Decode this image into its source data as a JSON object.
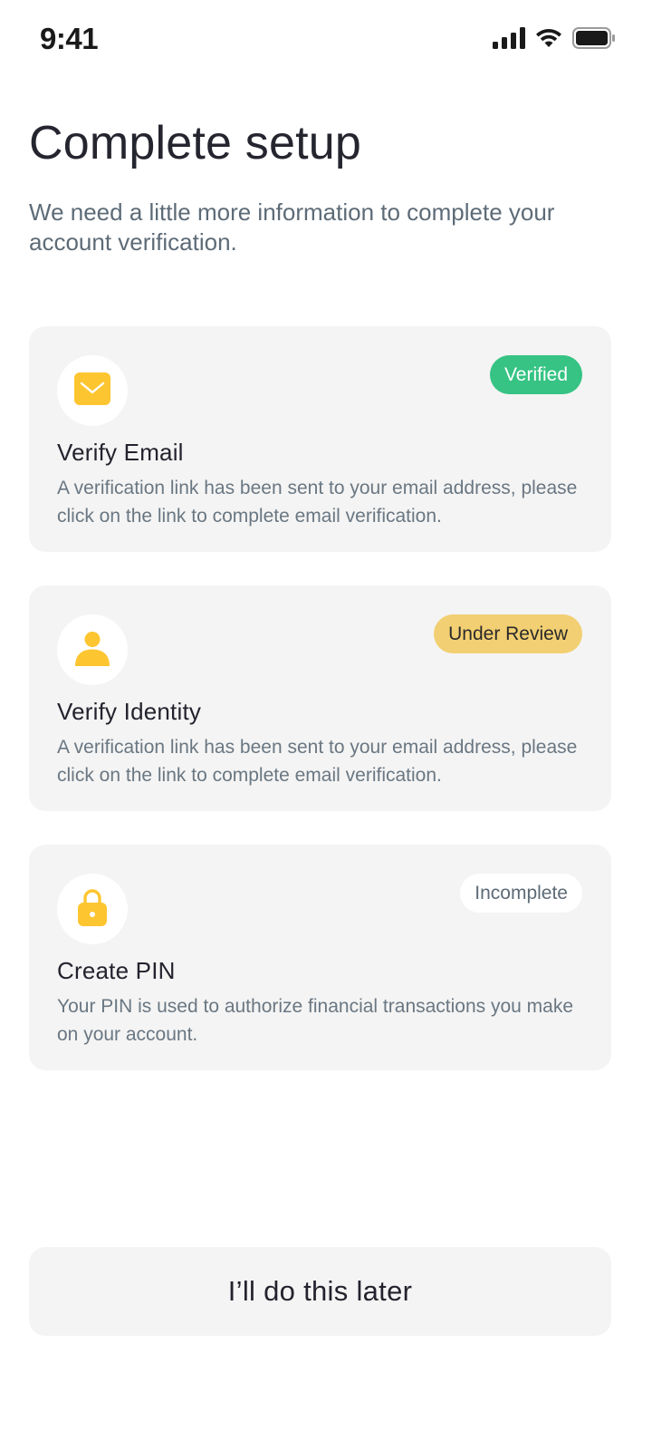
{
  "status_bar": {
    "time": "9:41",
    "icons": [
      "cellular-signal-icon",
      "wifi-icon",
      "battery-icon"
    ]
  },
  "header": {
    "title": "Complete setup",
    "subtitle": "We need a little more information to complete your account verification."
  },
  "cards": [
    {
      "icon": "envelope-icon",
      "title": "Verify Email",
      "description": "A verification link has been sent to your email address, please click on the link to complete email verification.",
      "status": "Verified",
      "status_color": "#36c384"
    },
    {
      "icon": "user-icon",
      "title": "Verify Identity",
      "description": "A verification link has been sent to your email address, please click on the link to complete email verification.",
      "status": "Under Review",
      "status_color": "#f2cf72"
    },
    {
      "icon": "lock-icon",
      "title": "Create PIN",
      "description": "Your PIN is used to authorize financial transactions you make on your account.",
      "status": "Incomplete",
      "status_color": "#ffffff"
    }
  ],
  "colors": {
    "accent": "#fdc530",
    "card_background": "#f4f4f4",
    "text_primary": "#23232e",
    "text_secondary": "#5d6b77"
  },
  "footer": {
    "later_label": "I’ll do this later"
  }
}
